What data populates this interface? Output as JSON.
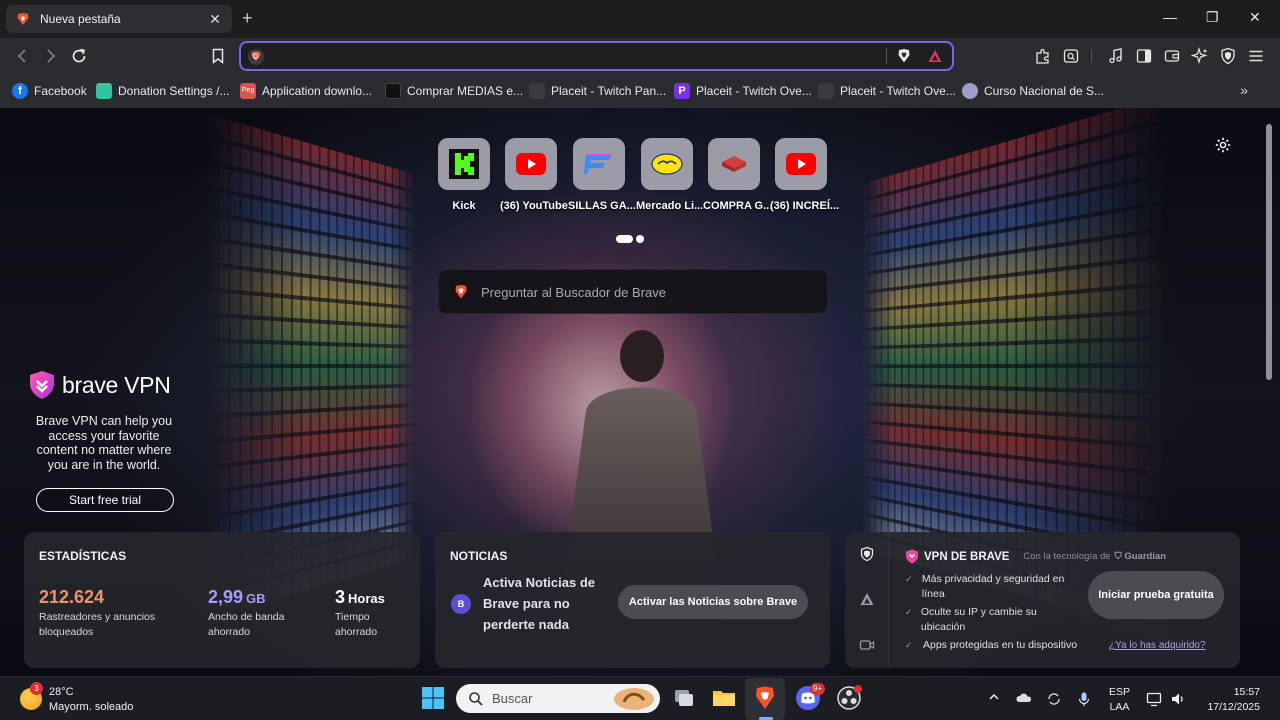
{
  "tab": {
    "title": "Nueva pestaña",
    "close": "✕",
    "new": "+"
  },
  "window": {
    "minimize": "—",
    "maximize": "❐",
    "close": "✕"
  },
  "address": {
    "value": "",
    "placeholder": ""
  },
  "bookmarks": [
    {
      "label": "Facebook",
      "icon": "facebook-icon",
      "color": "#1877f2"
    },
    {
      "label": "Donation Settings /...",
      "icon": "streamlabs-icon",
      "color": "#31c3a2"
    },
    {
      "label": "Application downlo...",
      "icon": "peg-icon",
      "color": "#d9534f"
    },
    {
      "label": "Comprar MEDIAS e...",
      "icon": "store-icon",
      "color": "#222222"
    },
    {
      "label": "Placeit - Twitch Pan...",
      "icon": "placeit-icon",
      "color": "#3a3a3f"
    },
    {
      "label": "Placeit - Twitch Ove...",
      "icon": "placeit-p-icon",
      "color": "#7a2ee8"
    },
    {
      "label": "Placeit - Twitch Ove...",
      "icon": "placeit-icon",
      "color": "#3a3a3f"
    },
    {
      "label": "Curso Nacional de S...",
      "icon": "course-icon",
      "color": "#9aa0c8"
    }
  ],
  "top_sites": [
    {
      "label": "Kick",
      "icon": "kick-icon"
    },
    {
      "label": "(36) YouTube",
      "icon": "youtube-icon"
    },
    {
      "label": "SILLAS GA...",
      "icon": "sillas-icon"
    },
    {
      "label": "Mercado Li...",
      "icon": "mercadolibre-icon"
    },
    {
      "label": "COMPRA G...",
      "icon": "compra-icon"
    },
    {
      "label": "(36) INCREÍ...",
      "icon": "youtube-icon"
    }
  ],
  "search": {
    "placeholder": "Preguntar al Buscador de Brave"
  },
  "vpn_promo": {
    "name": "brave VPN",
    "text": "Brave VPN can help you access your favorite content no matter where you are in the world.",
    "button": "Start free trial"
  },
  "stats": {
    "title": "ESTADÍSTICAS",
    "trackers": {
      "value": "212.624",
      "label": "Rastreadores y anuncios bloqueados",
      "color": "#f0916a"
    },
    "bandwidth": {
      "value": "2,99",
      "unit": "GB",
      "label": "Ancho de banda ahorrado",
      "color": "#a59cf7"
    },
    "time": {
      "value": "3",
      "unit": "Horas",
      "label": "Tiempo ahorrado",
      "color": "#ffffff"
    }
  },
  "news": {
    "title": "NOTICIAS",
    "badge": "B",
    "text": "Activa Noticias de Brave para no perderte nada",
    "button": "Activar las Noticias sobre Brave"
  },
  "vpn_card": {
    "title": "VPN DE BRAVE",
    "powered": "Con la tecnología de",
    "partner": "Guardian",
    "features": [
      "Más privacidad y seguridad en línea",
      "Oculte su IP y cambie su ubicación",
      "Apps protegidas en tu dispositivo"
    ],
    "button": "Iniciar prueba gratuita",
    "link": "¿Ya lo has adquirido?"
  },
  "taskbar": {
    "weather_temp": "28°C",
    "weather_desc": "Mayorm. soleado",
    "weather_badge": "3",
    "search": "Buscar",
    "discord_badge": "9+",
    "lang_top": "ESP",
    "lang_bottom": "LAA",
    "time": "15:57",
    "date": "17/12/2025"
  }
}
